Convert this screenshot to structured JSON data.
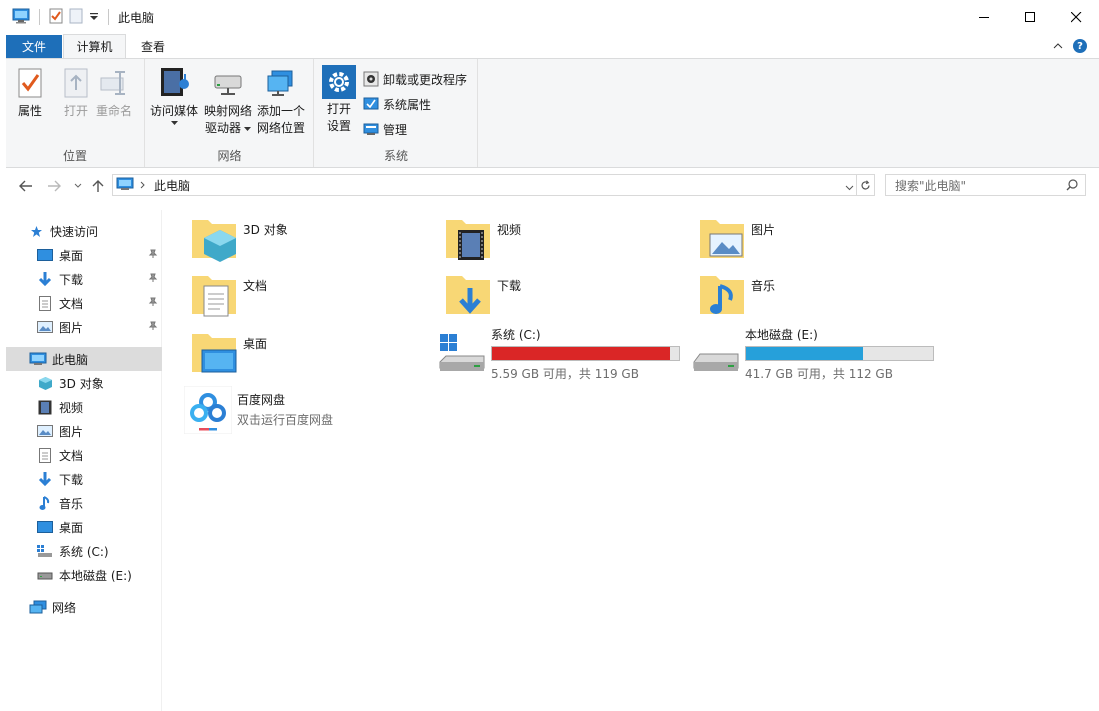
{
  "window": {
    "title": "此电脑",
    "controls": [
      "minimize-icon",
      "maximize-icon",
      "close-icon"
    ]
  },
  "ribbon": {
    "tabs": {
      "file": "文件",
      "computer": "计算机",
      "view": "查看"
    },
    "location_group": {
      "label": "位置",
      "properties": "属性",
      "open": "打开",
      "rename": "重命名"
    },
    "network_group": {
      "label": "网络",
      "access_media": "访问媒体",
      "map_drive_1": "映射网络",
      "map_drive_2": "驱动器",
      "add_location_1": "添加一个",
      "add_location_2": "网络位置"
    },
    "system_group": {
      "label": "系统",
      "open_settings_1": "打开",
      "open_settings_2": "设置",
      "uninstall": "卸载或更改程序",
      "system_properties": "系统属性",
      "manage": "管理"
    }
  },
  "address": {
    "path": "此电脑",
    "search_placeholder": "搜索\"此电脑\""
  },
  "sidebar": {
    "quick_access": "快速访问",
    "quick_items": [
      "桌面",
      "下载",
      "文档",
      "图片"
    ],
    "this_pc": "此电脑",
    "pc_items": [
      "3D 对象",
      "视频",
      "图片",
      "文档",
      "下载",
      "音乐",
      "桌面",
      "系统 (C:)",
      "本地磁盘 (E:)"
    ],
    "network": "网络"
  },
  "folders": [
    "3D 对象",
    "视频",
    "图片",
    "文档",
    "下载",
    "音乐",
    "桌面"
  ],
  "drives": [
    {
      "name": "系统 (C:)",
      "free_text": "5.59 GB 可用，共 119 GB",
      "used_fraction": 0.953,
      "color": "#da2626"
    },
    {
      "name": "本地磁盘 (E:)",
      "free_text": "41.7 GB 可用，共 112 GB",
      "used_fraction": 0.628,
      "color": "#26a0da"
    }
  ],
  "apps": [
    {
      "name": "百度网盘",
      "subtitle": "双击运行百度网盘"
    }
  ],
  "colors": {
    "accent": "#1e6fb9",
    "folder": "#f8d775",
    "selection": "#dcdcdc"
  }
}
